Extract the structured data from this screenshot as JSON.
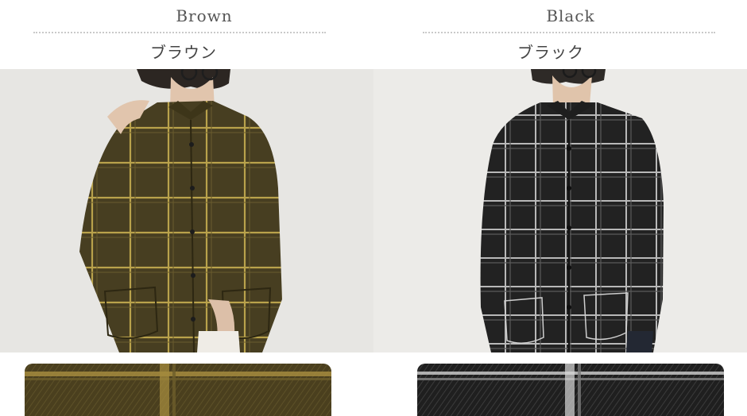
{
  "colors": [
    {
      "name_en": "Brown",
      "name_ja": "ブラウン",
      "fabric_base": "#4e4424",
      "check_line": "#b9a24b",
      "background": "#e7e6e3"
    },
    {
      "name_en": "Black",
      "name_ja": "ブラック",
      "fabric_base": "#2a2a2a",
      "check_line": "#b8b8b8",
      "background": "#ecebe8"
    }
  ]
}
